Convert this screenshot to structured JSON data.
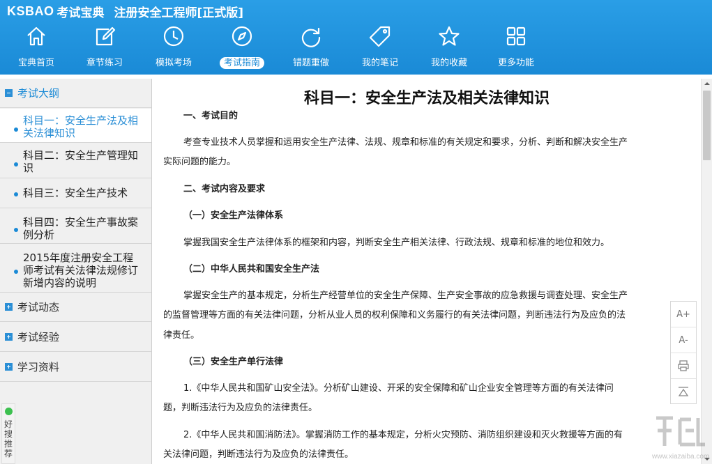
{
  "app": {
    "brand_logo": "KSBAO",
    "brand_cn": "考试宝典",
    "title": "注册安全工程师[正式版]"
  },
  "nav": [
    {
      "label": "宝典首页",
      "icon": "home-icon"
    },
    {
      "label": "章节练习",
      "icon": "edit-icon"
    },
    {
      "label": "模拟考场",
      "icon": "clock-icon"
    },
    {
      "label": "考试指南",
      "icon": "compass-icon",
      "active": true
    },
    {
      "label": "错题重做",
      "icon": "redo-icon"
    },
    {
      "label": "我的笔记",
      "icon": "tag-icon"
    },
    {
      "label": "我的收藏",
      "icon": "star-icon"
    },
    {
      "label": "更多功能",
      "icon": "grid-icon"
    }
  ],
  "sidebar": {
    "sections": [
      {
        "label": "考试大纲",
        "open": true
      },
      {
        "label": "考试动态",
        "open": false
      },
      {
        "label": "考试经验",
        "open": false
      },
      {
        "label": "学习资料",
        "open": false
      }
    ],
    "items": [
      {
        "label": "科目一：安全生产法及相关法律知识",
        "active": true
      },
      {
        "label": "科目二：安全生产管理知识"
      },
      {
        "label": "科目三：安全生产技术"
      },
      {
        "label": "科目四：安全生产事故案例分析"
      },
      {
        "label": "2015年度注册安全工程师考试有关法律法规修订新增内容的说明"
      }
    ],
    "haosou": "好搜推荐"
  },
  "doc": {
    "title": "科目一：安全生产法及相关法律知识",
    "h1": "一、考试目的",
    "p1": "考查专业技术人员掌握和运用安全生产法律、法规、规章和标准的有关规定和要求，分析、判断和解决安全生产",
    "p1b": "实际问题的能力。",
    "h2": "二、考试内容及要求",
    "h3": "（一）安全生产法律体系",
    "p3": "掌握我国安全生产法律体系的框架和内容，判断安全生产相关法律、行政法规、规章和标准的地位和效力。",
    "h4": "（二）中华人民共和国安全生产法",
    "p4": "掌握安全生产的基本规定，分析生产经营单位的安全生产保障、生产安全事故的应急救援与调查处理、安全生产",
    "p4b": "的监督管理等方面的有关法律问题，分析从业人员的权利保障和义务履行的有关法律问题，判断违法行为及应负的法",
    "p4c": "律责任。",
    "h5": "（三）安全生产单行法律",
    "p5": "1.《中华人民共和国矿山安全法》。分析矿山建设、开采的安全保障和矿山企业安全管理等方面的有关法律问",
    "p5b": "题，判断违法行为及应负的法律责任。",
    "p6": "2.《中华人民共和国消防法》。掌握消防工作的基本规定，分析火灾预防、消防组织建设和灭火救援等方面的有",
    "p6b": "关法律问题，判断违法行为及应负的法律责任。"
  },
  "tools": {
    "font_up": "A+",
    "font_down": "A-"
  },
  "watermark": {
    "url": "www.xiazaiba.com"
  }
}
